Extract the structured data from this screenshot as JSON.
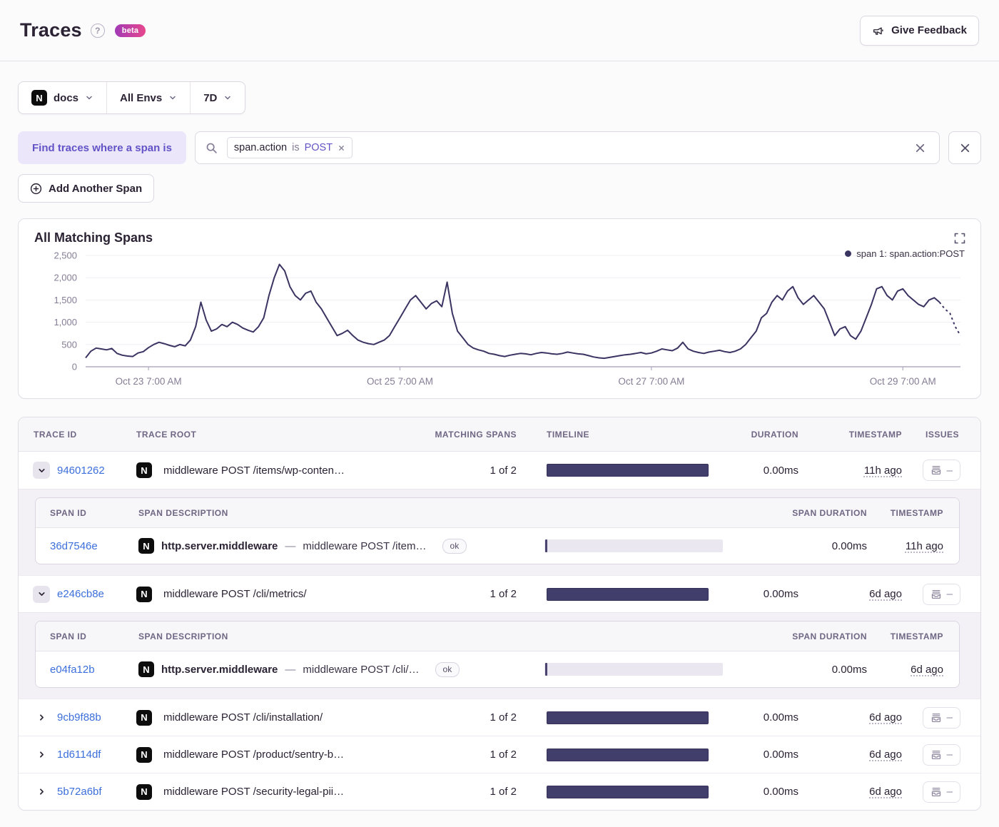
{
  "colors": {
    "accent": "#6254c7",
    "link": "#3c6fdb",
    "chart_line": "#3a3462",
    "timeline_bar": "#423e6c",
    "beta_from": "#a13ab6",
    "beta_to": "#e7478d"
  },
  "header": {
    "title": "Traces",
    "help": "?",
    "beta_label": "beta",
    "feedback_label": "Give Feedback"
  },
  "filters": {
    "project": "docs",
    "environment": "All Envs",
    "period": "7D"
  },
  "query": {
    "label": "Find traces where a span is",
    "token": {
      "key": "span.action",
      "op": "is",
      "value": "POST"
    },
    "add_span_label": "Add Another Span"
  },
  "icons": {
    "nextjs_letter": "N"
  },
  "chart_data": {
    "type": "line",
    "title": "All Matching Spans",
    "xlabel": "",
    "ylabel": "",
    "ylim": [
      0,
      2500
    ],
    "y_ticks": [
      0,
      500,
      1000,
      1500,
      2000,
      2500
    ],
    "grid": "horizontal",
    "legend_position": "top-right",
    "dashed_tail_points": 4,
    "x_ticks": [
      {
        "index": 12,
        "label": "Oct 23 7:00 AM"
      },
      {
        "index": 60,
        "label": "Oct 25 7:00 AM"
      },
      {
        "index": 108,
        "label": "Oct 27 7:00 AM"
      },
      {
        "index": 156,
        "label": "Oct 29 7:00 AM"
      }
    ],
    "series": [
      {
        "name": "span 1: span.action:POST",
        "color": "#3a3462",
        "values": [
          200,
          350,
          420,
          400,
          380,
          410,
          300,
          260,
          240,
          230,
          310,
          340,
          430,
          500,
          550,
          520,
          480,
          450,
          500,
          470,
          600,
          900,
          1450,
          1050,
          800,
          850,
          950,
          900,
          1000,
          950,
          870,
          820,
          780,
          900,
          1100,
          1600,
          2000,
          2300,
          2150,
          1800,
          1600,
          1500,
          1650,
          1700,
          1450,
          1300,
          1100,
          900,
          700,
          750,
          820,
          700,
          600,
          550,
          520,
          500,
          550,
          600,
          700,
          900,
          1100,
          1300,
          1500,
          1600,
          1450,
          1300,
          1420,
          1480,
          1350,
          1900,
          1200,
          800,
          650,
          500,
          420,
          380,
          350,
          300,
          280,
          250,
          230,
          260,
          280,
          300,
          290,
          270,
          300,
          320,
          310,
          290,
          280,
          300,
          330,
          310,
          290,
          280,
          250,
          220,
          200,
          190,
          210,
          230,
          250,
          270,
          280,
          300,
          320,
          290,
          310,
          350,
          400,
          380,
          360,
          420,
          550,
          400,
          350,
          320,
          300,
          330,
          350,
          370,
          340,
          320,
          350,
          400,
          500,
          650,
          800,
          1100,
          1200,
          1450,
          1600,
          1500,
          1700,
          1800,
          1550,
          1400,
          1500,
          1600,
          1450,
          1300,
          1000,
          700,
          850,
          900,
          700,
          620,
          800,
          1100,
          1400,
          1750,
          1800,
          1600,
          1500,
          1700,
          1750,
          1600,
          1500,
          1400,
          1350,
          1500,
          1550,
          1450,
          1300,
          1200,
          900,
          700
        ]
      }
    ]
  },
  "table": {
    "columns": [
      "TRACE ID",
      "TRACE ROOT",
      "MATCHING SPANS",
      "TIMELINE",
      "DURATION",
      "TIMESTAMP",
      "ISSUES"
    ],
    "span_columns": [
      "SPAN ID",
      "SPAN DESCRIPTION",
      "SPAN DURATION",
      "TIMESTAMP"
    ],
    "issues_placeholder": "–",
    "span_separator": "—",
    "rows": [
      {
        "trace_id": "94601262",
        "expanded": true,
        "root": "middleware POST /items/wp-conten…",
        "matching": "1 of 2",
        "duration": "0.00ms",
        "timestamp": "11h ago",
        "spans": [
          {
            "span_id": "36d7546e",
            "op": "http.server.middleware",
            "desc": "middleware POST /item…",
            "status": "ok",
            "duration": "0.00ms",
            "timestamp": "11h ago"
          }
        ]
      },
      {
        "trace_id": "e246cb8e",
        "expanded": true,
        "root": "middleware POST /cli/metrics/",
        "matching": "1 of 2",
        "duration": "0.00ms",
        "timestamp": "6d ago",
        "spans": [
          {
            "span_id": "e04fa12b",
            "op": "http.server.middleware",
            "desc": "middleware POST /cli/…",
            "status": "ok",
            "duration": "0.00ms",
            "timestamp": "6d ago"
          }
        ]
      },
      {
        "trace_id": "9cb9f88b",
        "expanded": false,
        "root": "middleware POST /cli/installation/",
        "matching": "1 of 2",
        "duration": "0.00ms",
        "timestamp": "6d ago",
        "spans": []
      },
      {
        "trace_id": "1d6114df",
        "expanded": false,
        "root": "middleware POST /product/sentry-b…",
        "matching": "1 of 2",
        "duration": "0.00ms",
        "timestamp": "6d ago",
        "spans": []
      },
      {
        "trace_id": "5b72a6bf",
        "expanded": false,
        "root": "middleware POST /security-legal-pii…",
        "matching": "1 of 2",
        "duration": "0.00ms",
        "timestamp": "6d ago",
        "spans": []
      }
    ]
  }
}
